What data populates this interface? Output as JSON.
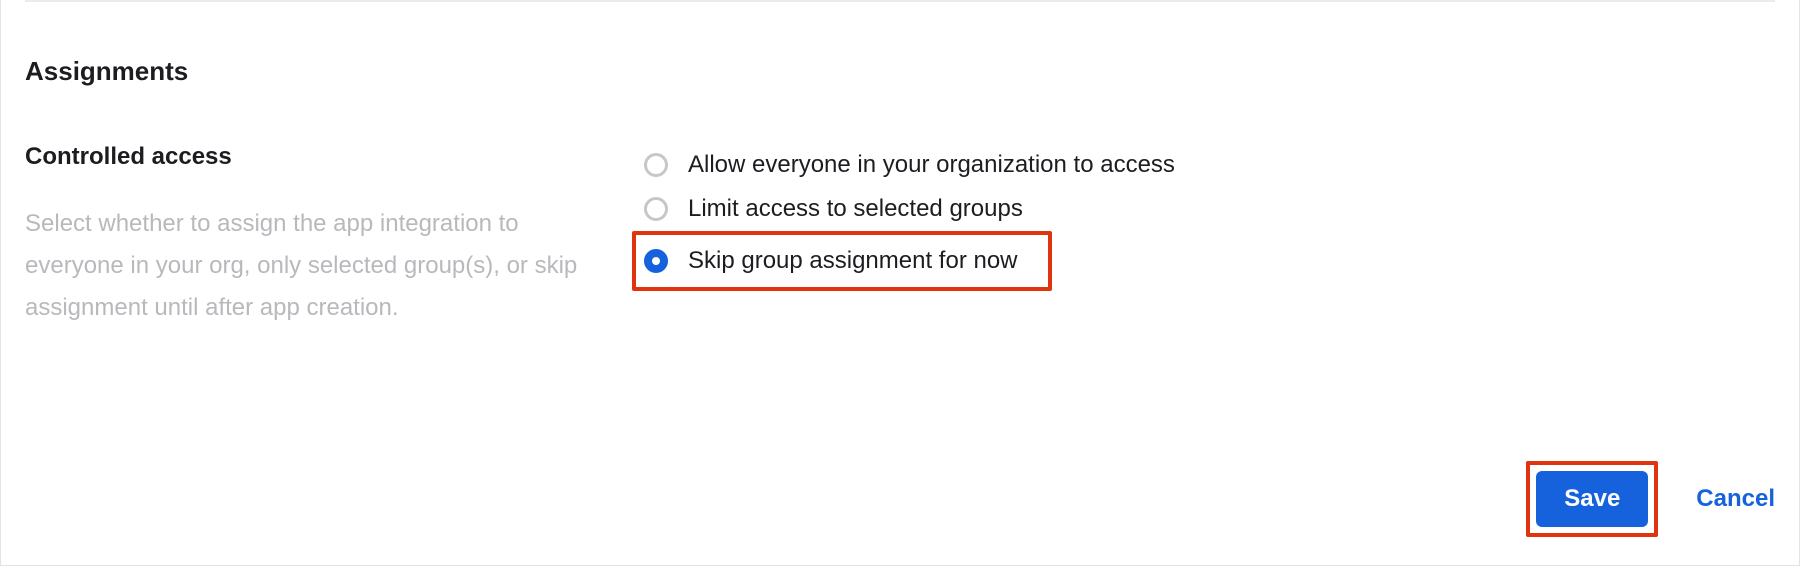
{
  "section": {
    "title": "Assignments",
    "subheading": "Controlled access",
    "description": "Select whether to assign the app integration to everyone in your org, only selected group(s), or skip assignment until after app creation."
  },
  "options": [
    {
      "label": "Allow everyone in your organization to access",
      "selected": false,
      "highlight": false
    },
    {
      "label": "Limit access to selected groups",
      "selected": false,
      "highlight": false
    },
    {
      "label": "Skip group assignment for now",
      "selected": true,
      "highlight": true
    }
  ],
  "actions": {
    "save": "Save",
    "cancel": "Cancel"
  },
  "colors": {
    "accent": "#1662dd",
    "highlight_border": "#e0340f"
  }
}
